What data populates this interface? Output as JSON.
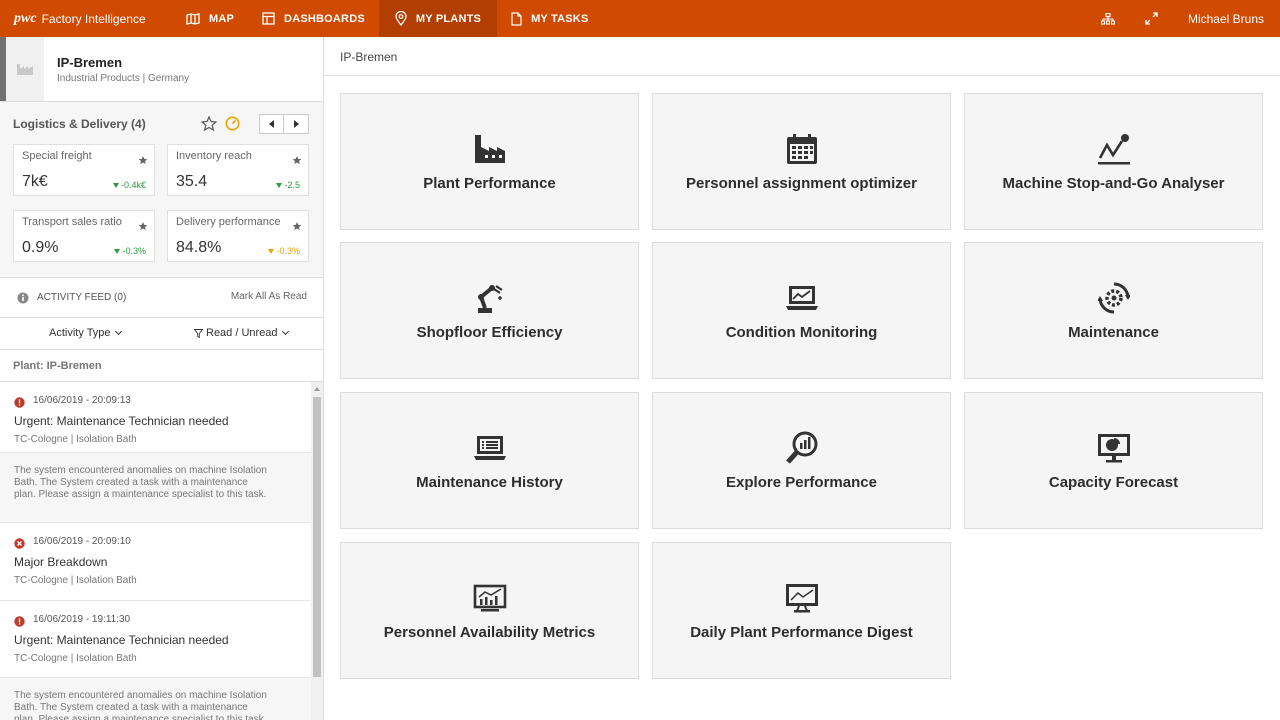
{
  "nav": {
    "brand_logo": "pwc",
    "brand_app": "Factory Intelligence",
    "items": [
      {
        "label": "MAP",
        "icon": "map-icon"
      },
      {
        "label": "DASHBOARDS",
        "icon": "dashboard-icon"
      },
      {
        "label": "MY PLANTS",
        "icon": "location-pin-icon",
        "active": true
      },
      {
        "label": "MY TASKS",
        "icon": "document-icon"
      }
    ],
    "user": "Michael Bruns",
    "accent_color": "#d04a02"
  },
  "plant": {
    "name": "IP-Bremen",
    "subtitle": "Industrial Products | Germany"
  },
  "kpi": {
    "heading": "Logistics & Delivery (4)",
    "cards": [
      {
        "label": "Special freight",
        "value": "7k€",
        "delta": "-0.4k€",
        "delta_color": "#2e9b3f"
      },
      {
        "label": "Inventory reach",
        "value": "35.4",
        "delta": "-2.5",
        "delta_color": "#2e9b3f"
      },
      {
        "label": "Transport sales ratio",
        "value": "0.9%",
        "delta": "-0.3%",
        "delta_color": "#2e9b3f"
      },
      {
        "label": "Delivery performance",
        "value": "84.8%",
        "delta": "-0.3%",
        "delta_color": "#e0a800"
      }
    ]
  },
  "feed": {
    "title": "ACTIVITY FEED (0)",
    "mark_all": "Mark All As Read",
    "filter_type": "Activity Type",
    "filter_read": "Read / Unread",
    "plant_label": "Plant: IP-Bremen",
    "items": [
      {
        "time": "16/06/2019 - 20:09:13",
        "title": "Urgent: Maintenance Technician needed",
        "location": "TC-Cologne | Isolation Bath",
        "icon": "alert-icon"
      },
      {
        "time": "16/06/2019 - 20:09:10",
        "title": "Major Breakdown",
        "location": "TC-Cologne | Isolation Bath",
        "icon": "error-icon"
      },
      {
        "time": "16/06/2019 - 19:11:30",
        "title": "Urgent: Maintenance Technician needed",
        "location": "TC-Cologne | Isolation Bath",
        "icon": "alert-icon"
      }
    ],
    "description": "The system encountered anomalies on machine Isolation Bath. The System created a task with a maintenance plan. Please assign a maintenance specialist to this task."
  },
  "main": {
    "breadcrumb": "IP-Bremen",
    "tiles": [
      {
        "label": "Plant Performance",
        "icon": "factory-icon"
      },
      {
        "label": "Personnel assignment optimizer",
        "icon": "calendar-icon"
      },
      {
        "label": "Machine Stop-and-Go Analyser",
        "icon": "line-chart-icon"
      },
      {
        "label": "Shopfloor Efficiency",
        "icon": "robot-arm-icon"
      },
      {
        "label": "Condition Monitoring",
        "icon": "laptop-chart-icon"
      },
      {
        "label": "Maintenance",
        "icon": "gear-refresh-icon"
      },
      {
        "label": "Maintenance History",
        "icon": "laptop-list-icon"
      },
      {
        "label": "Explore Performance",
        "icon": "magnifier-chart-icon"
      },
      {
        "label": "Capacity Forecast",
        "icon": "monitor-pie-icon"
      },
      {
        "label": "Personnel Availability Metrics",
        "icon": "bar-chart-board-icon"
      },
      {
        "label": "Daily Plant Performance Digest",
        "icon": "monitor-line-icon"
      }
    ]
  }
}
